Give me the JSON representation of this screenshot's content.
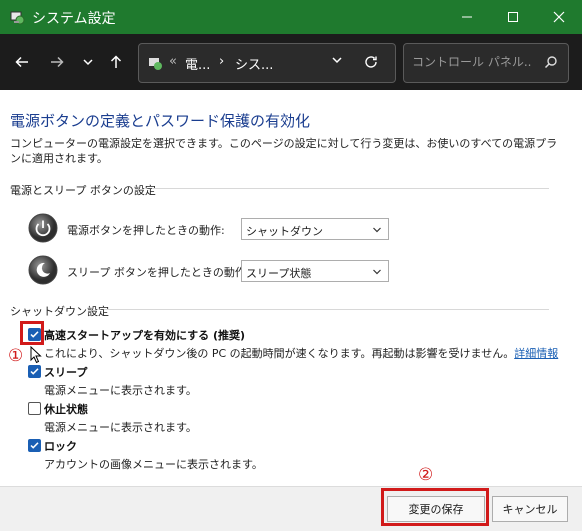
{
  "window": {
    "title": "システム設定",
    "minimize": "—",
    "maximize": "☐",
    "close": "✕"
  },
  "nav": {
    "back": "←",
    "forward": "→",
    "recent": "⌄",
    "up": "↑",
    "address_overflow": "«",
    "breadcrumb": [
      "電...",
      "シス..."
    ],
    "sep": "›",
    "address_dropdown": "⌄",
    "search_placeholder": "コントロール パネル..."
  },
  "page": {
    "title": "電源ボタンの定義とパスワード保護の有効化",
    "description": "コンピューターの電源設定を選択できます。このページの設定に対して行う変更は、お使いのすべての電源プランに適用されます。"
  },
  "power_section": {
    "heading": "電源とスリープ ボタンの設定",
    "rows": [
      {
        "label": "電源ボタンを押したときの動作:",
        "value": "シャットダウン",
        "icon": "power-button-icon"
      },
      {
        "label": "スリープ ボタンを押したときの動作:",
        "value": "スリープ状態",
        "icon": "sleep-button-icon"
      }
    ]
  },
  "shutdown_section": {
    "heading": "シャットダウン設定",
    "options": [
      {
        "label": "高速スタートアップを有効にする (推奨)",
        "checked": true,
        "desc": "これにより、シャットダウン後の PC の起動時間が速くなります。再起動は影響を受けません。",
        "link": "詳細情報"
      },
      {
        "label": "スリープ",
        "checked": true,
        "desc": "電源メニューに表示されます。"
      },
      {
        "label": "休止状態",
        "checked": false,
        "desc": "電源メニューに表示されます。"
      },
      {
        "label": "ロック",
        "checked": true,
        "desc": "アカウントの画像メニューに表示されます。"
      }
    ]
  },
  "footer": {
    "save": "変更の保存",
    "cancel": "キャンセル"
  },
  "annotations": {
    "step1": "①",
    "step2": "②",
    "color": "#d11a1a"
  },
  "colors": {
    "titlebar": "#1f7a2e",
    "navbar": "#1c1c1c",
    "title_text": "#1a3d8f",
    "link": "#1a5fb4",
    "checkbox": "#1a5fb4"
  }
}
